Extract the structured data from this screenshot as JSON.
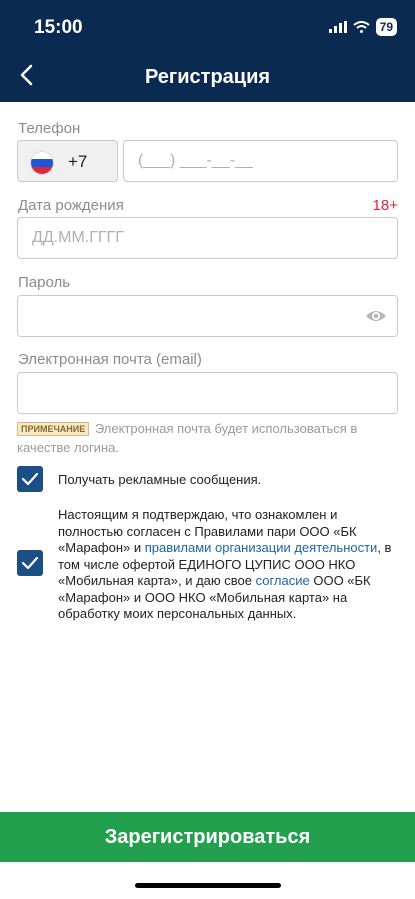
{
  "status": {
    "time": "15:00",
    "battery": "79"
  },
  "header": {
    "title": "Регистрация"
  },
  "phone": {
    "label": "Телефон",
    "country_code": "+7",
    "placeholder": "(___) ___-__-__"
  },
  "birthdate": {
    "label": "Дата рождения",
    "age_badge": "18+",
    "placeholder": "ДД.ММ.ГГГГ"
  },
  "password": {
    "label": "Пароль",
    "value": ""
  },
  "email": {
    "label": "Электронная почта (email)",
    "value": ""
  },
  "note": {
    "badge": "ПРИМЕЧАНИЕ",
    "text": "Электронная почта будет использоваться в качестве логина."
  },
  "checkboxes": {
    "ads": {
      "checked": true,
      "label": "Получать рекламные сообщения."
    },
    "agreement": {
      "checked": true,
      "part1": "Настоящим я подтверждаю, что ознакомлен и полностью согласен с Правилами пари ООО «БК «Марафон» и ",
      "link1": "правилами организации деятельности",
      "part2": ", в том числе офертой ЕДИНОГО ЦУПИС ООО НКО «Мобильная карта», и даю свое ",
      "link2": "согласие",
      "part3": " ООО «БК «Марафон» и ООО НКО «Мобильная карта» на обработку моих персональных данных."
    }
  },
  "submit": {
    "label": "Зарегистрироваться"
  },
  "colors": {
    "header": "#0b2a52",
    "accent_green": "#23a04d",
    "checkbox": "#1b4f86",
    "link": "#1d63a6",
    "age": "#e0263a"
  }
}
